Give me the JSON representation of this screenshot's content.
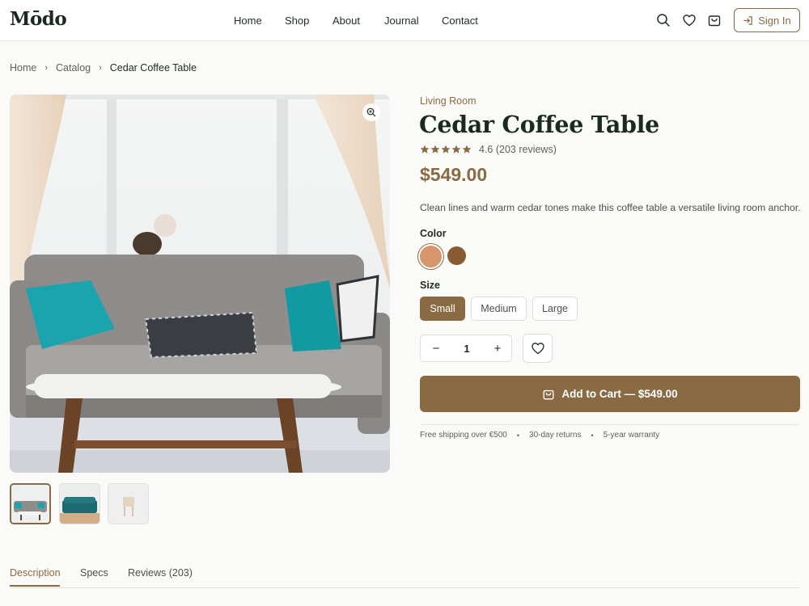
{
  "brand": {
    "logo": "Mōdo"
  },
  "nav": {
    "items": [
      "Home",
      "Shop",
      "About",
      "Journal",
      "Contact"
    ]
  },
  "header": {
    "sign_in": "Sign In",
    "icons": [
      "search-icon",
      "heart-icon",
      "bag-icon"
    ]
  },
  "breadcrumb": {
    "items": [
      "Home",
      "Catalog",
      "Cedar Coffee Table"
    ]
  },
  "product": {
    "category": "Living Room",
    "title": "Cedar Coffee Table",
    "rating": 4.6,
    "rating_text": "4.6 (203 reviews)",
    "stars": 5,
    "price": "$549.00",
    "description": "Clean lines and warm cedar tones make this coffee table a versatile living room anchor.",
    "color_label": "Color",
    "colors": [
      "#d6956a",
      "#8a5a30"
    ],
    "selected_color": 0,
    "size_label": "Size",
    "sizes": [
      "Small",
      "Medium",
      "Large"
    ],
    "selected_size": "Small",
    "quantity": "1",
    "add_to_cart": "Add to Cart — $549.00",
    "perks": [
      "Free shipping over €500",
      "30-day returns",
      "5-year warranty"
    ]
  },
  "gallery": {
    "thumbnails": 3,
    "active": 0
  },
  "tabs": [
    "Description",
    "Specs",
    "Reviews (203)"
  ],
  "active_tab": "Description",
  "colors": {
    "accent": "#8a6a43",
    "text": "#1f2a24",
    "muted": "#5c625e",
    "star": "#8a6a43"
  }
}
